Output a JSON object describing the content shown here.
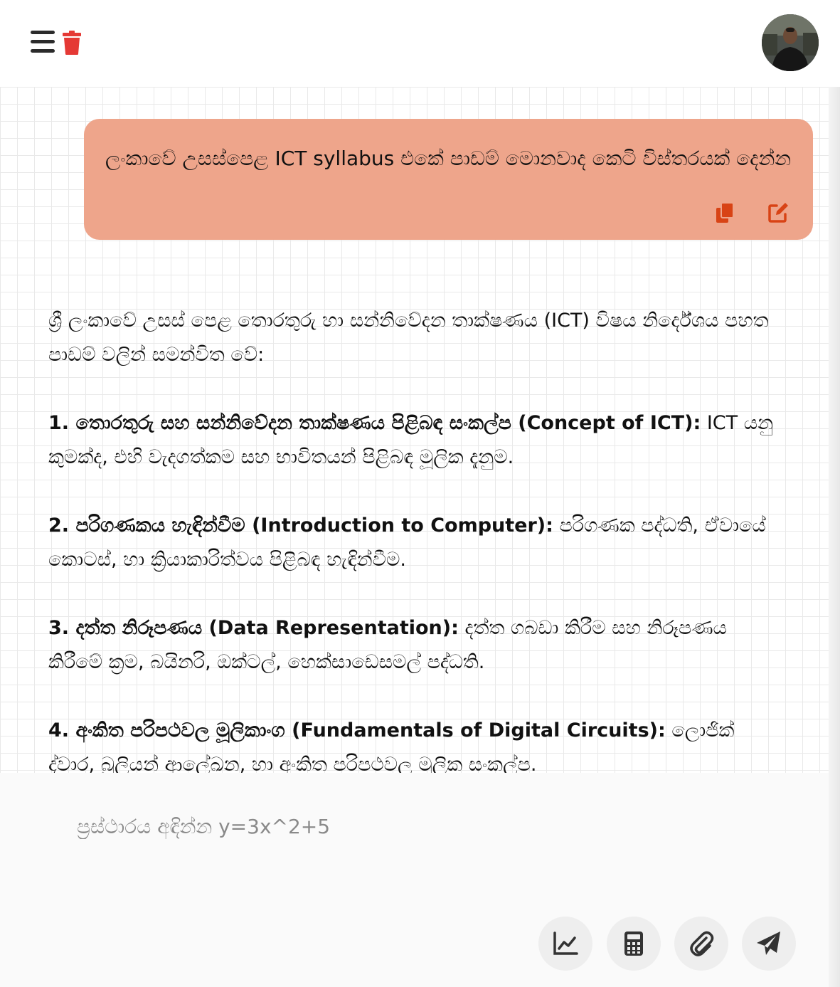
{
  "header": {
    "menu_icon": "hamburger-menu-icon",
    "delete_icon": "trash-icon",
    "accent_red": "#e53935"
  },
  "user_message": {
    "text": "ලංකාවේ උසස්පෙළ ICT syllabus එකේ පාඩම් මොනවාද කෙටි විස්තරයක් දෙන්න",
    "bubble_color": "#eea58b",
    "icon_color": "#d84315"
  },
  "assistant_reply": {
    "intro": "ශ්‍රී ලංකාවේ උසස් පෙළ තොරතුරු හා සන්නිවේදන තාක්ෂණය (ICT) විෂය නිර්දේශය පහත පාඩම් වලින් සමන්විත වේ:",
    "items": [
      {
        "title": "1. තොරතුරු සහ සන්නිවේදන තාක්ෂණය පිළිබඳ සංකල්ප (Concept of ICT):",
        "desc": " ICT යනු කුමක්ද, එහි වැදගත්කම සහ භාවිතයන් පිළිබඳ මූලික දැනුම."
      },
      {
        "title": "2. පරිගණකය හැඳින්වීම (Introduction to Computer):",
        "desc": " පරිගණක පද්ධති, ඒවායේ කොටස්, හා ක්‍රියාකාරිත්වය පිළිබඳ හැඳින්වීම."
      },
      {
        "title": "3. දත්ත නිරූපණය (Data Representation):",
        "desc": " දත්ත ගබඩා කිරීම සහ නිරූපණය කිරීමේ ක්‍රම, බයිනරි, ඔක්ටල්, හෙක්සාඩෙසමල් පද්ධති."
      },
      {
        "title": "4. අංකිත පරිපථවල මූලිකාංග (Fundamentals of Digital Circuits):",
        "desc": " ලොජික් ද්වාර, බූලියන් ආලේඛන, හා අංකිත පරිපථවල මූලික සංකල්ප."
      }
    ]
  },
  "composer": {
    "placeholder": "ප්‍රස්ථාරය අඳින්න y=3x^2+5",
    "value": "",
    "buttons": [
      "chart-icon",
      "calculator-icon",
      "paperclip-icon",
      "send-icon"
    ]
  }
}
